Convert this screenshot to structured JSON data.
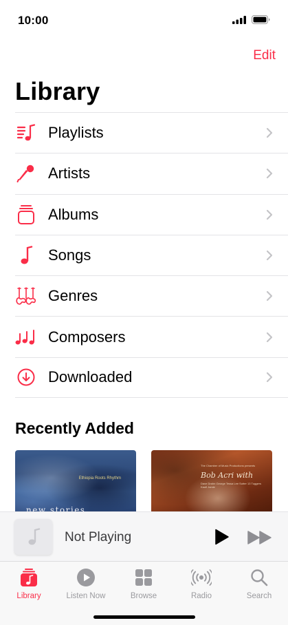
{
  "status_bar": {
    "time": "10:00",
    "signal_icon": "cellular-signal-icon",
    "battery_icon": "battery-full-icon"
  },
  "header": {
    "edit_label": "Edit",
    "title": "Library"
  },
  "library": {
    "items": [
      {
        "label": "Playlists",
        "icon": "playlist-icon"
      },
      {
        "label": "Artists",
        "icon": "microphone-icon"
      },
      {
        "label": "Albums",
        "icon": "album-stack-icon"
      },
      {
        "label": "Songs",
        "icon": "music-note-icon"
      },
      {
        "label": "Genres",
        "icon": "guitars-icon"
      },
      {
        "label": "Composers",
        "icon": "music-notes-icon"
      },
      {
        "label": "Downloaded",
        "icon": "download-circle-icon"
      }
    ]
  },
  "recently_added": {
    "title": "Recently Added",
    "albums": [
      {
        "title_text": "new stories",
        "small_text": "Ethiopia Roots Rhythm"
      },
      {
        "script_text": "Bob Acri with",
        "head_text": "The Chamber of Music Productions presents",
        "fine_text": "Dave Drahn George Tessa Lee Sutter 13 Tuggers Kaufi Jamie"
      }
    ]
  },
  "mini_player": {
    "title": "Not Playing"
  },
  "tab_bar": {
    "tabs": [
      {
        "label": "Library",
        "icon": "library-icon",
        "active": true
      },
      {
        "label": "Listen Now",
        "icon": "play-circle-icon",
        "active": false
      },
      {
        "label": "Browse",
        "icon": "grid-icon",
        "active": false
      },
      {
        "label": "Radio",
        "icon": "radio-waves-icon",
        "active": false
      },
      {
        "label": "Search",
        "icon": "search-icon",
        "active": false
      }
    ]
  },
  "colors": {
    "accent": "#fa2d48",
    "inactive_tab": "#9a9a9e",
    "separator": "#e3e3e6"
  }
}
